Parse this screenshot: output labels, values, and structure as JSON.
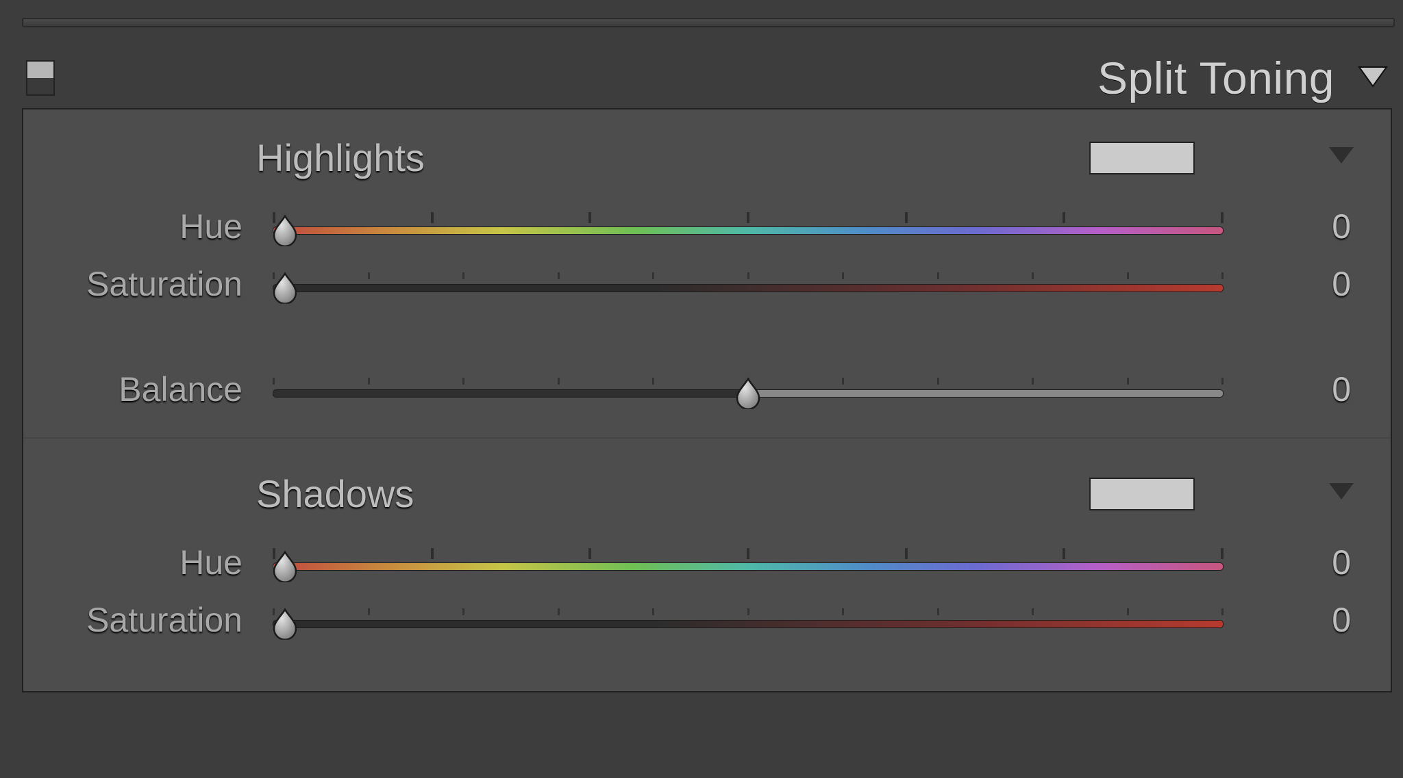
{
  "panel": {
    "title": "Split Toning",
    "highlights": {
      "label": "Highlights",
      "hue": {
        "label": "Hue",
        "value": "0"
      },
      "saturation": {
        "label": "Saturation",
        "value": "0"
      }
    },
    "balance": {
      "label": "Balance",
      "value": "0"
    },
    "shadows": {
      "label": "Shadows",
      "hue": {
        "label": "Hue",
        "value": "0"
      },
      "saturation": {
        "label": "Saturation",
        "value": "0"
      }
    }
  }
}
